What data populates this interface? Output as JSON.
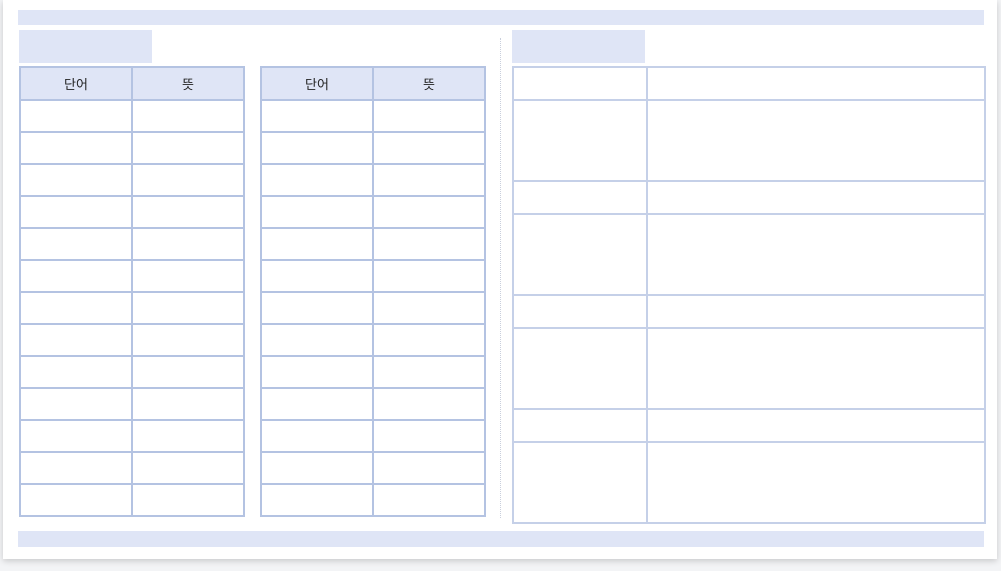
{
  "vocab_left": {
    "headers": {
      "word": "단어",
      "meaning": "뜻"
    }
  },
  "vocab_right": {
    "headers": {
      "word": "단어",
      "meaning": "뜻"
    }
  },
  "colors": {
    "band": "#dfe5f6",
    "grid_border": "#b4c3e2",
    "notes_border": "#c5d0e8",
    "page": "#ffffff",
    "background": "#f3f4f6"
  }
}
